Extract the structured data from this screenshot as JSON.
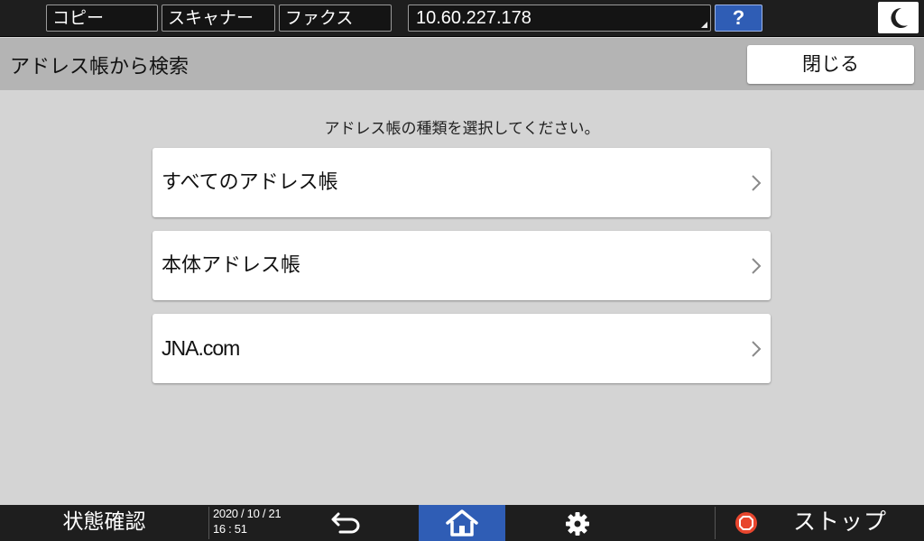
{
  "topbar": {
    "tabs": [
      {
        "label": "コピー"
      },
      {
        "label": "スキャナー"
      },
      {
        "label": "ファクス"
      }
    ],
    "ip_address": "10.60.227.178",
    "help_label": "?"
  },
  "header": {
    "title": "アドレス帳から検索",
    "close_label": "閉じる"
  },
  "main": {
    "instruction": "アドレス帳の種類を選択してください。",
    "items": [
      {
        "label": "すべてのアドレス帳"
      },
      {
        "label": "本体アドレス帳"
      },
      {
        "label": "JNA.com"
      }
    ]
  },
  "bottombar": {
    "status_label": "状態確認",
    "date": "2020 / 10 / 21",
    "time": "16 : 51",
    "stop_label": "ストップ"
  },
  "colors": {
    "accent_blue": "#2f5db5",
    "stop_red": "#e8462e",
    "bar_dark": "#1e1e1e",
    "header_gray": "#b4b4b4",
    "background_gray": "#d4d4d4"
  },
  "icons": {
    "sleep": "crescent-moon-icon",
    "back": "back-arrow-icon",
    "home": "home-icon",
    "settings": "gear-icon",
    "stop": "stop-icon",
    "chevron": "chevron-right-icon"
  }
}
